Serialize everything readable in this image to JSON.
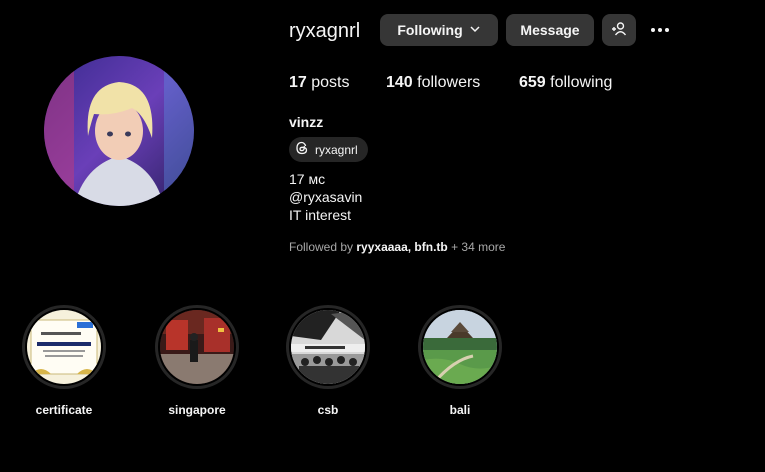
{
  "profile": {
    "username": "ryxagnrl",
    "full_name": "vinzz",
    "threads_handle": "ryxagnrl",
    "bio_lines": [
      "17 мс",
      "@ryxasavin",
      "IT interest"
    ]
  },
  "actions": {
    "following_label": "Following",
    "message_label": "Message",
    "add_user_icon": "add-user-icon",
    "more_icon": "more-options-icon"
  },
  "stats": {
    "posts_count": "17",
    "posts_label": "posts",
    "followers_count": "140",
    "followers_label": "followers",
    "following_count": "659",
    "following_label": "following"
  },
  "followed_by": {
    "prefix": "Followed by",
    "users": "ryyxaaaa, bfn.tb",
    "suffix": "+ 34 more"
  },
  "highlights": [
    {
      "label": "certificate"
    },
    {
      "label": "singapore"
    },
    {
      "label": "csb"
    },
    {
      "label": "bali"
    }
  ]
}
